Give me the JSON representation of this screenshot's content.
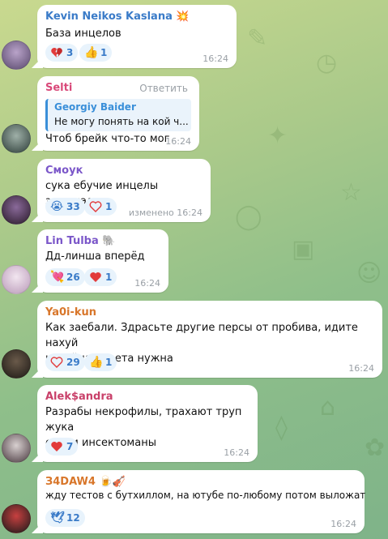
{
  "messages": [
    {
      "author": "Kevin Neikos Kaslana",
      "author_emoji": "💥",
      "author_color": "#3a7bc8",
      "text": "База инцелов",
      "time": "16:24",
      "reactions": [
        {
          "icon": "broken-heart-icon",
          "count": "3"
        },
        {
          "icon": "thumbs-up-icon",
          "count": "1"
        }
      ]
    },
    {
      "author": "Selti",
      "author_color": "#d94a7a",
      "reply_label": "Ответить",
      "quote": {
        "author": "Georgiy Baider",
        "text": "Не могу понять на кой ч..."
      },
      "text": "Чтоб брейк что-то мог",
      "time": "16:24"
    },
    {
      "author": "Смоук",
      "author_color": "#7b57c9",
      "text": "сука ебучие инцелы зарешали",
      "time": "изменено 16:24",
      "reactions": [
        {
          "icon": "crying-face-icon",
          "count": "33"
        },
        {
          "icon": "heart-outline-icon",
          "count": "1"
        }
      ]
    },
    {
      "author": "Lin Tulba",
      "author_emoji": "🐘",
      "author_color": "#7b57c9",
      "text": "Дд-линша вперёд",
      "time": "16:24",
      "reactions": [
        {
          "icon": "heart-arrow-icon",
          "count": "26"
        },
        {
          "icon": "red-heart-icon",
          "count": "1"
        }
      ]
    },
    {
      "author": "Ya0i-kun",
      "author_color": "#d8762a",
      "text": "Как заебали. Здрасьте другие персы от пробива, идите нахуй",
      "text2": "китайцам света нужна",
      "time": "16:24",
      "reactions": [
        {
          "icon": "heart-outline-icon",
          "count": "29"
        },
        {
          "icon": "thumbs-up-icon",
          "count": "1"
        }
      ]
    },
    {
      "author": "Alek$andra",
      "author_color": "#c9416a",
      "text": "Разрабы некрофилы, трахают труп жука",
      "text2": "еще и инсектоманы",
      "time": "16:24",
      "reactions": [
        {
          "icon": "red-heart-icon",
          "count": "7"
        }
      ]
    },
    {
      "author": "З4DAW4",
      "author_emoji": "🍺🎻",
      "author_color": "#d8762a",
      "text": "жду тестов с бутхиллом, на ютубе по-любому потом выложат",
      "time": "16:24",
      "reactions": [
        {
          "icon": "dove-icon",
          "count": "12"
        }
      ]
    }
  ]
}
